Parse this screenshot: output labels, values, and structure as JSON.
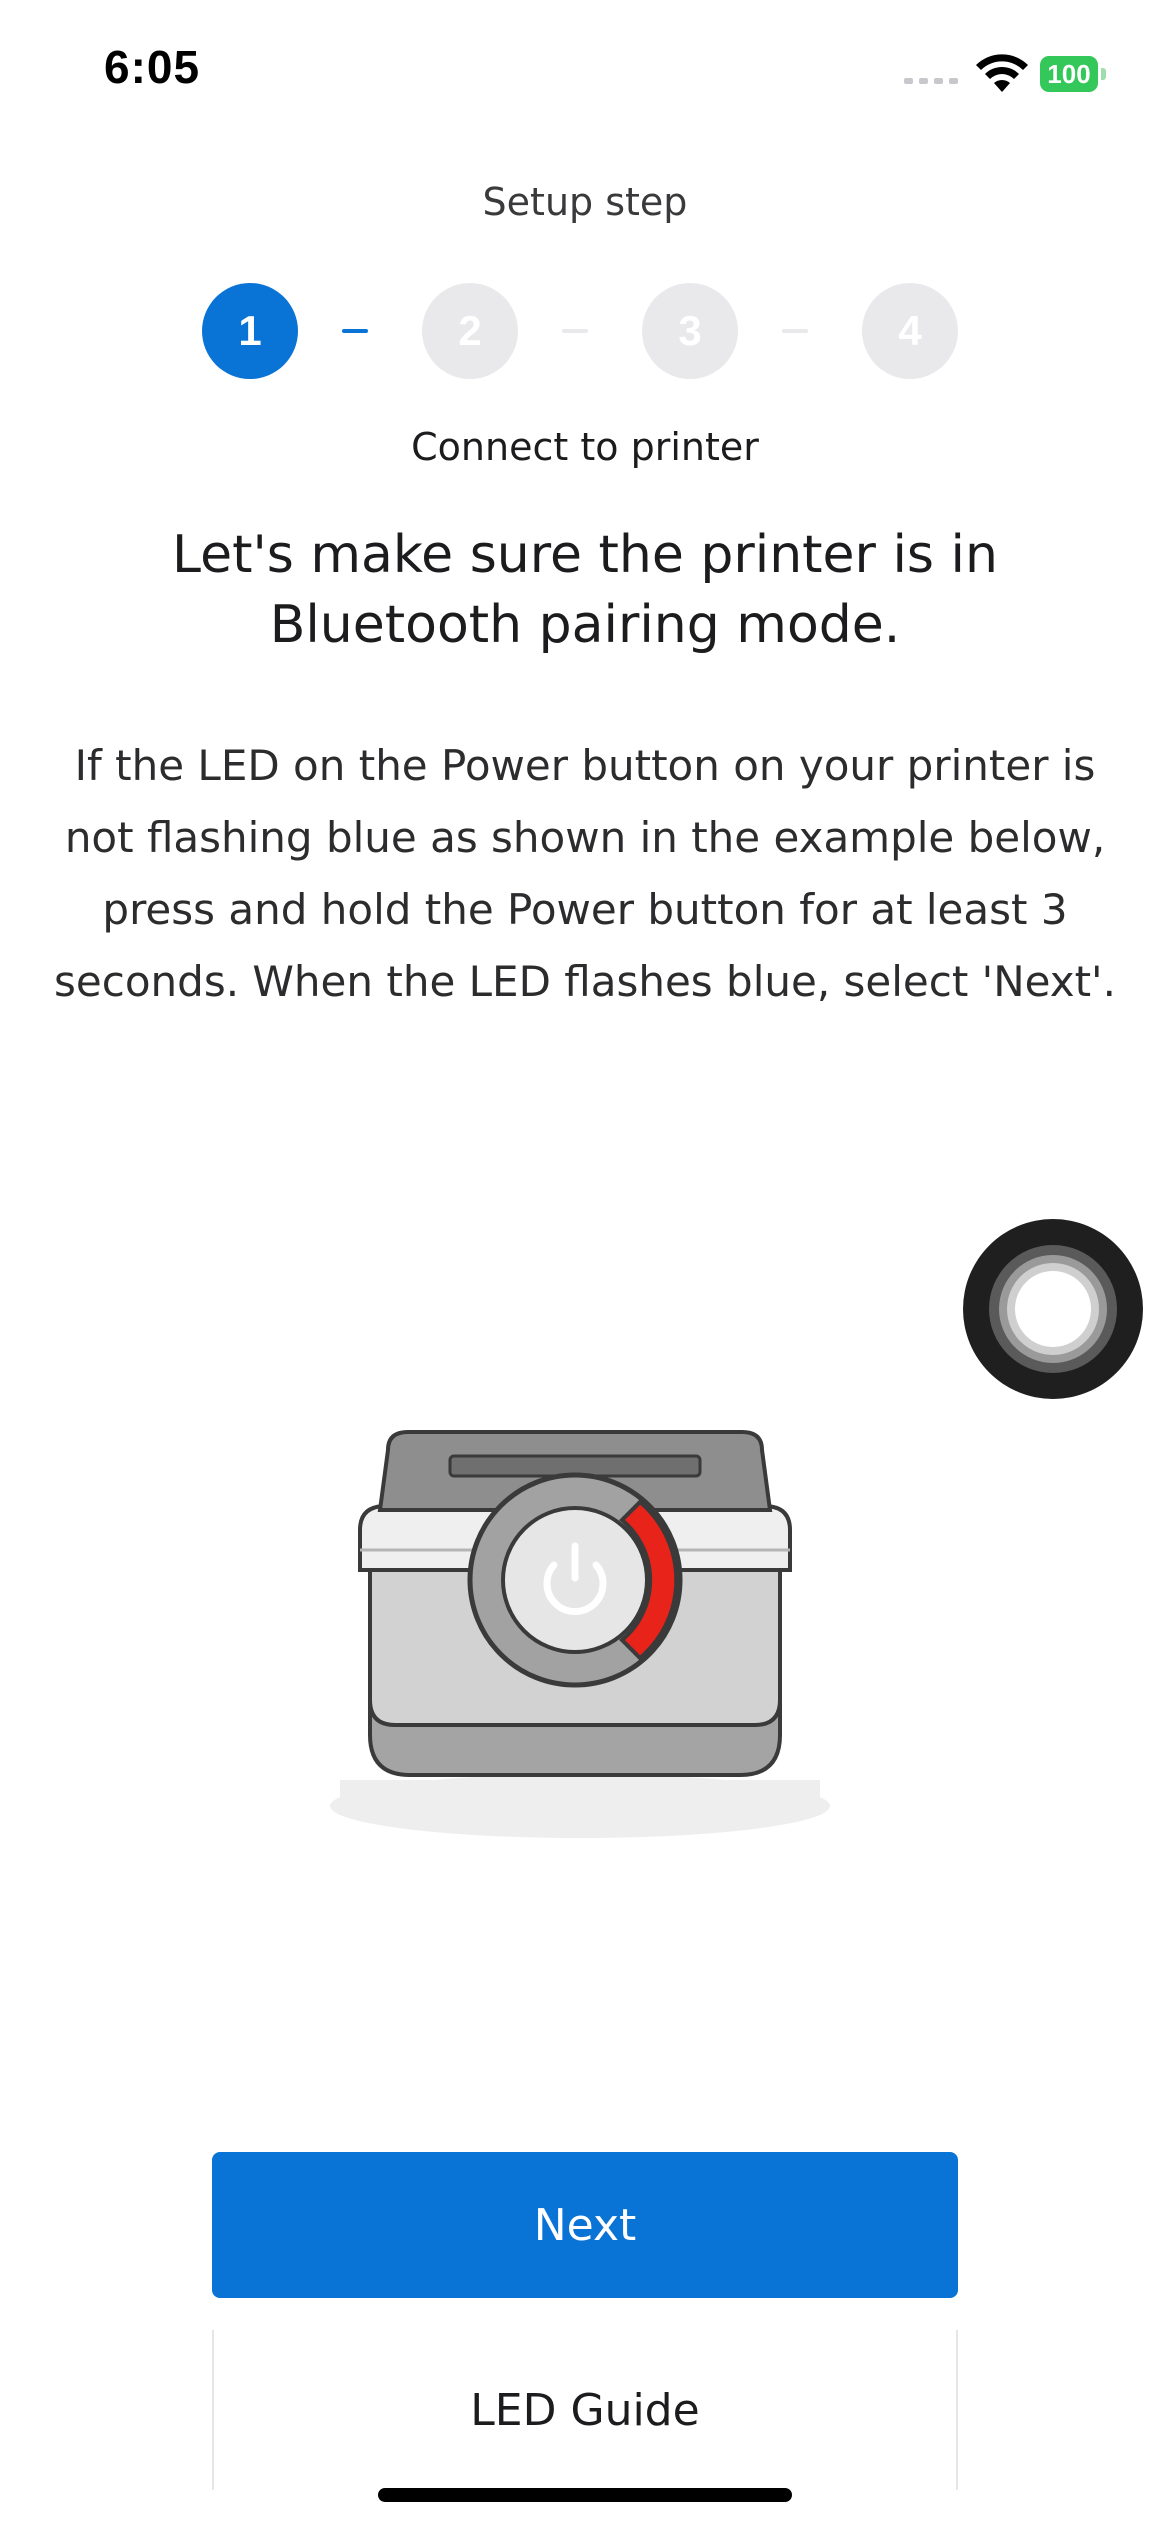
{
  "status_bar": {
    "time": "6:05",
    "battery": "100",
    "icons": [
      "signal-icon",
      "wifi-icon",
      "battery-icon"
    ]
  },
  "stepper": {
    "label": "Setup step",
    "steps": [
      "1",
      "2",
      "3",
      "4"
    ],
    "active_step": 1,
    "current_step_title": "Connect to printer"
  },
  "content": {
    "headline": "Let's make sure the printer is in Bluetooth pairing mode.",
    "body": "If the LED on the Power button on your printer is not flashing blue as shown in the example below, press and hold the Power button for at least 3 seconds. When the LED flashes blue, select 'Next'."
  },
  "illustration": {
    "icon": "printer-power-led-icon",
    "led_color": "#e8231a"
  },
  "actions": {
    "next_label": "Next",
    "led_guide_label": "LED Guide"
  },
  "colors": {
    "accent": "#0a74d6",
    "inactive": "#e9e9eb"
  }
}
